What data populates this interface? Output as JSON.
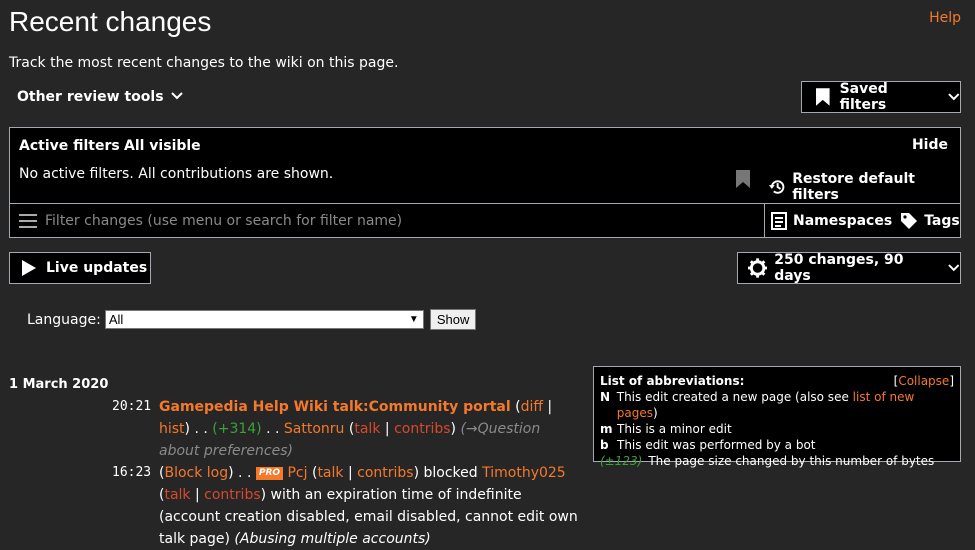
{
  "header": {
    "title": "Recent changes",
    "help": "Help",
    "subtitle": "Track the most recent changes to the wiki on this page.",
    "other_tools": "Other review tools",
    "saved_filters": "Saved filters"
  },
  "filters": {
    "active_label": "Active filters",
    "all_visible": "All visible",
    "hide": "Hide",
    "no_filters": "No active filters. All contributions are shown.",
    "restore": "Restore default filters",
    "placeholder": "Filter changes (use menu or search for filter name)",
    "namespaces": "Namespaces",
    "tags": "Tags"
  },
  "controls": {
    "live_updates": "Live updates",
    "changes_summary": "250 changes, 90 days",
    "language_label": "Language:",
    "language_value": "All",
    "show": "Show"
  },
  "date_heading": "1 March 2020",
  "entries": [
    {
      "time": "20:21",
      "page": "Gamepedia Help Wiki talk:Community portal",
      "diff": "diff",
      "hist": "hist",
      "size_change": "(+314)",
      "user": "Sattonru",
      "talk": "talk",
      "contribs": "contribs",
      "summary": "(→Question about preferences)"
    },
    {
      "time": "16:23",
      "block_log": "Block log",
      "badge": "PRO",
      "user": "Pcj",
      "talk": "talk",
      "contribs": "contribs",
      "action": "blocked",
      "target": "Timothy025",
      "target_talk": "talk",
      "target_contribs": "contribs",
      "details": "with an expiration time of indefinite (account creation disabled, email disabled, cannot edit own talk page)",
      "reason": "(Abusing multiple accounts)"
    }
  ],
  "abbreviations": {
    "title": "List of abbreviations:",
    "collapse": "Collapse",
    "n_key": "N",
    "n_text": "This edit created a new page (also see ",
    "n_link": "list of new pages",
    "m_key": "m",
    "m_text": "This is a minor edit",
    "b_key": "b",
    "b_text": "This edit was performed by a bot",
    "size_key": "(±123)",
    "size_text": "The page size changed by this number of bytes"
  },
  "colors": {
    "link": "#f5792a",
    "redlink": "#d6492d",
    "positive": "#3aa23a",
    "background": "#262626",
    "panel": "#000000"
  }
}
